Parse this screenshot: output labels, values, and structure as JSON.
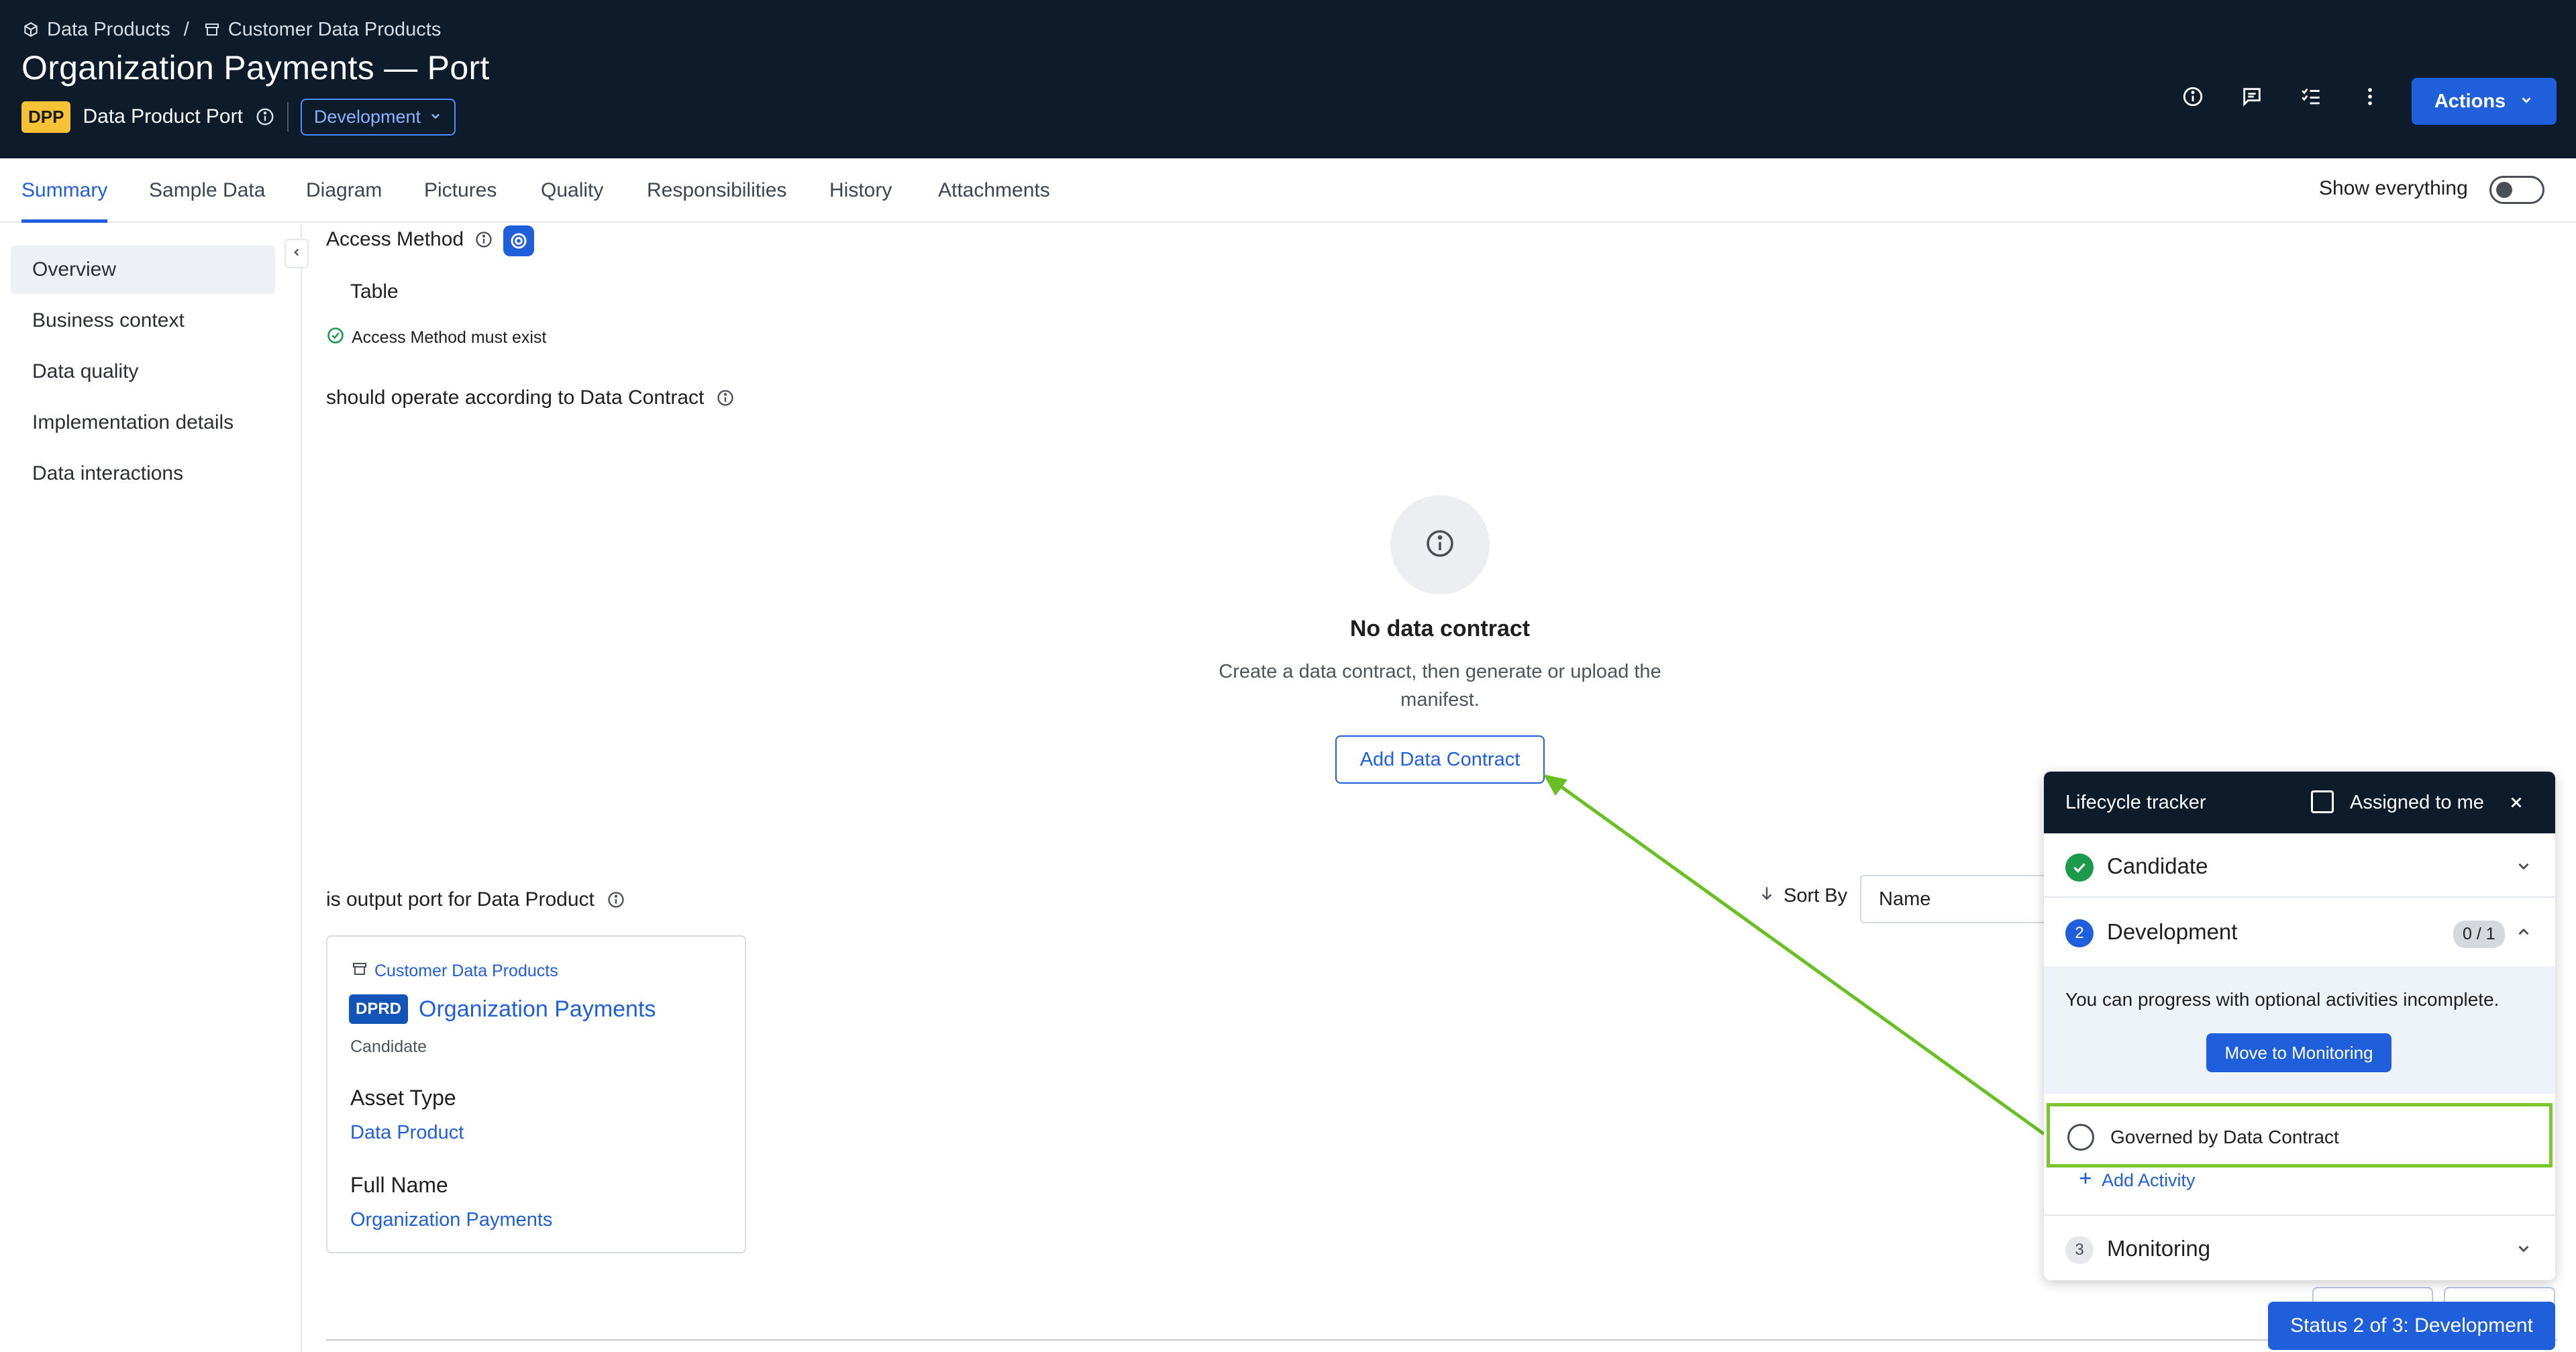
{
  "header": {
    "breadcrumb": [
      "Data Products",
      "Customer Data Products"
    ],
    "breadcrumb_sep": "/",
    "title": "Organization Payments — Port",
    "badge": "DPP",
    "asset_type": "Data Product Port",
    "status": "Development",
    "actions_label": "Actions",
    "icons": [
      "info-icon",
      "comment-icon",
      "checklist-icon",
      "more-vertical-icon"
    ],
    "colors": {
      "background": "#0d1b2a",
      "accent": "#1f5fdc",
      "badge": "#f5c335"
    }
  },
  "tabs": [
    {
      "label": "Summary",
      "active": true
    },
    {
      "label": "Sample Data"
    },
    {
      "label": "Diagram"
    },
    {
      "label": "Pictures"
    },
    {
      "label": "Quality"
    },
    {
      "label": "Responsibilities"
    },
    {
      "label": "History"
    },
    {
      "label": "Attachments"
    }
  ],
  "show_everything": {
    "label": "Show everything",
    "on": false
  },
  "sidebar": {
    "items": [
      {
        "label": "Overview",
        "active": true
      },
      {
        "label": "Business context"
      },
      {
        "label": "Data quality"
      },
      {
        "label": "Implementation details"
      },
      {
        "label": "Data interactions"
      }
    ]
  },
  "main": {
    "access_method": {
      "label": "Access Method",
      "value": "Table",
      "rule": "Access Method must exist"
    },
    "contract": {
      "label_prefix": "should operate according to",
      "label_target": "Data Contract",
      "empty_title": "No data contract",
      "empty_desc": "Create a data contract, then generate or upload the manifest.",
      "add_button": "Add Data Contract"
    },
    "output_port": {
      "label_prefix": "is output port for",
      "label_target": "Data Product",
      "sort_label": "Sort By",
      "sort_value": "Name",
      "card": {
        "domain": "Customer Data Products",
        "badge": "DPRD",
        "title": "Organization Payments",
        "status": "Candidate",
        "asset_type_label": "Asset Type",
        "asset_type_value": "Data Product",
        "full_name_label": "Full Name",
        "full_name_value": "Organization Payments"
      }
    }
  },
  "lifecycle": {
    "title": "Lifecycle tracker",
    "assigned_label": "Assigned to me",
    "stages": [
      {
        "name": "Candidate",
        "state": "done"
      },
      {
        "number": "2",
        "name": "Development",
        "count": "0 / 1",
        "state": "current"
      },
      {
        "number": "3",
        "name": "Monitoring",
        "state": "upcoming"
      }
    ],
    "dev_message": "You can progress with optional activities incomplete.",
    "move_button": "Move to Monitoring",
    "activity": "Governed by Data Contract",
    "add_activity": "Add Activity",
    "highlight_color": "#7bc62d"
  },
  "status_pill": "Status 2 of 3: Development"
}
